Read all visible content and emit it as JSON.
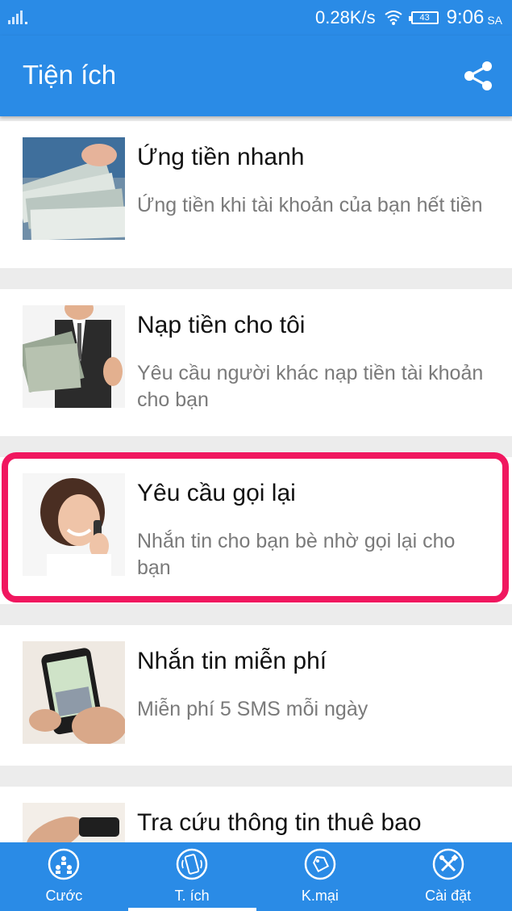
{
  "status_bar": {
    "net_speed": "0.28K/s",
    "battery_level": "43",
    "time": "9:06",
    "ampm": "SA"
  },
  "app_bar": {
    "title": "Tiện ích",
    "share_icon": "share-icon"
  },
  "items": [
    {
      "title": "Ứng tiền nhanh",
      "description": "Ứng tiền khi tài khoản của bạn hết tiền",
      "image": "money-cash-photo"
    },
    {
      "title": "Nạp tiền cho tôi",
      "description": "Yêu cầu người khác nạp tiền tài khoản cho bạn",
      "image": "man-holding-money-photo"
    },
    {
      "title": "Yêu cầu gọi lại",
      "description": "Nhắn tin cho bạn bè nhờ gọi lại cho bạn",
      "image": "woman-on-phone-photo",
      "highlighted": true
    },
    {
      "title": "Nhắn tin miễn phí",
      "description": "Miễn phí 5 SMS mỗi ngày",
      "image": "smartphone-sms-photo"
    },
    {
      "title": "Tra cứu thông tin thuê bao",
      "description": "",
      "image": "hand-phone-photo"
    }
  ],
  "bottom_nav": [
    {
      "label": "Cước",
      "icon": "people-icon",
      "active": false
    },
    {
      "label": "T. ích",
      "icon": "phone-icon",
      "active": true
    },
    {
      "label": "K.mại",
      "icon": "tag-icon",
      "active": false
    },
    {
      "label": "Cài đặt",
      "icon": "tools-icon",
      "active": false
    }
  ],
  "colors": {
    "primary": "#2a8be6",
    "highlight": "#f0175f",
    "background": "#ececec"
  }
}
